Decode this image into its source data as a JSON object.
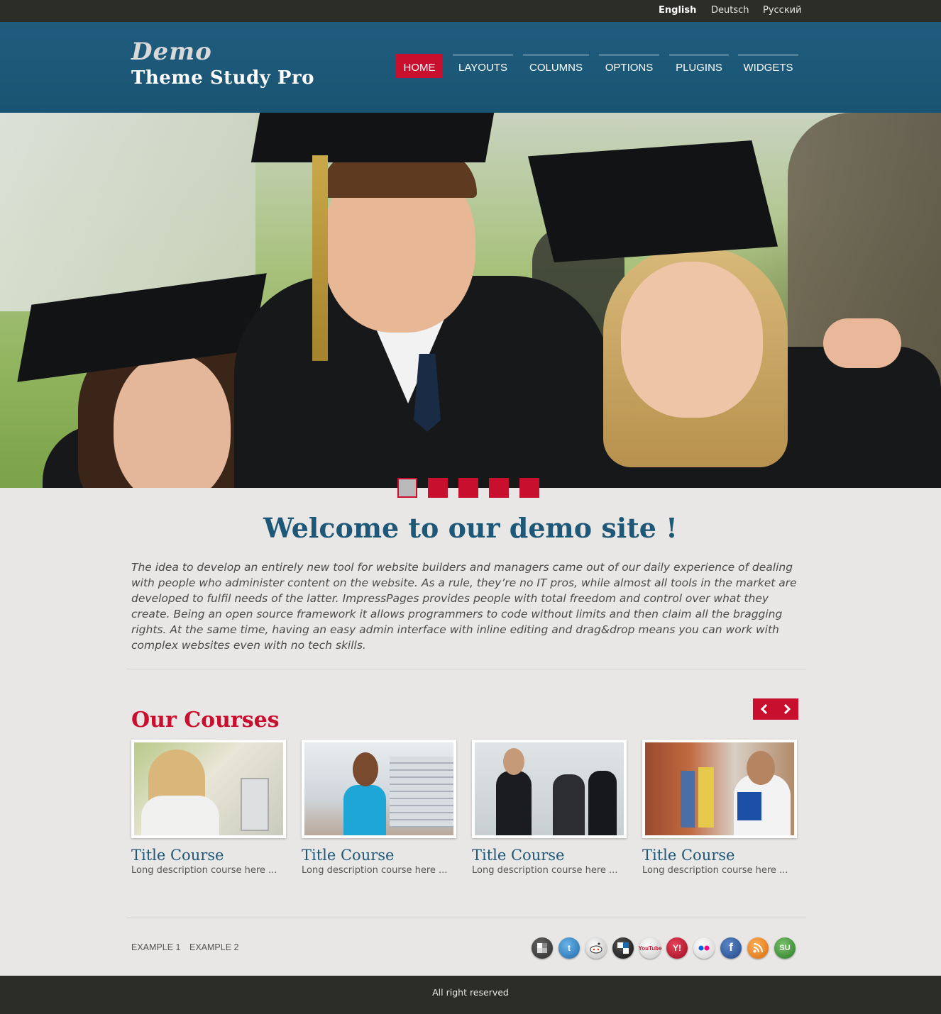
{
  "languages": [
    {
      "label": "English",
      "active": true
    },
    {
      "label": "Deutsch",
      "active": false
    },
    {
      "label": "Русский",
      "active": false
    }
  ],
  "logo": {
    "line1": "Demo",
    "line2": "Theme Study Pro"
  },
  "nav": [
    {
      "label": "HOME",
      "active": true
    },
    {
      "label": "LAYOUTS",
      "active": false
    },
    {
      "label": "COLUMNS",
      "active": false
    },
    {
      "label": "OPTIONS",
      "active": false
    },
    {
      "label": "PLUGINS",
      "active": false
    },
    {
      "label": "WIDGETS",
      "active": false
    }
  ],
  "slider": {
    "slide_count": 5,
    "active_index": 0
  },
  "welcome": {
    "title": "Welcome to our demo site !",
    "text": "The idea to develop an entirely new tool for website builders and managers came out of our daily experience of dealing with people who administer content on the website. As a rule, they’re no IT pros, while almost all tools in the market are developed to fulfil needs of the latter. ImpressPages provides people with total freedom and control over what they create. Being an open source framework it allows programmers to code without limits and then claim all the bragging rights. At the same time, having an easy admin interface with inline editing and drag&drop means you can work with complex websites even with no tech skills."
  },
  "courses": {
    "title": "Our Courses",
    "items": [
      {
        "title": "Title Course",
        "description": "Long description course here ..."
      },
      {
        "title": "Title Course",
        "description": "Long description course here ..."
      },
      {
        "title": "Title Course",
        "description": "Long description course here ..."
      },
      {
        "title": "Title Course",
        "description": "Long description course here ..."
      }
    ]
  },
  "footer": {
    "links": [
      "EXAMPLE 1",
      "EXAMPLE 2"
    ],
    "social": [
      {
        "icon": "delicious-icon",
        "color": "#3a3a3a"
      },
      {
        "icon": "twitter-icon",
        "color": "#2f7ec0"
      },
      {
        "icon": "reddit-icon",
        "color": "#d8d8d8"
      },
      {
        "icon": "delicious-alt-icon",
        "color": "#1a1a1a"
      },
      {
        "icon": "youtube-icon",
        "color": "#e0e0e0"
      },
      {
        "icon": "yahoo-icon",
        "color": "#c8102e"
      },
      {
        "icon": "flickr-icon",
        "color": "#e8e8e8"
      },
      {
        "icon": "facebook-icon",
        "color": "#2d5a9c"
      },
      {
        "icon": "rss-icon",
        "color": "#f08a1a"
      },
      {
        "icon": "stumbleupon-icon",
        "color": "#3f8b3a"
      }
    ],
    "copyright": "All right reserved"
  },
  "colors": {
    "primary": "#1d5878",
    "accent": "#c8102e",
    "dark": "#2c2d28"
  }
}
